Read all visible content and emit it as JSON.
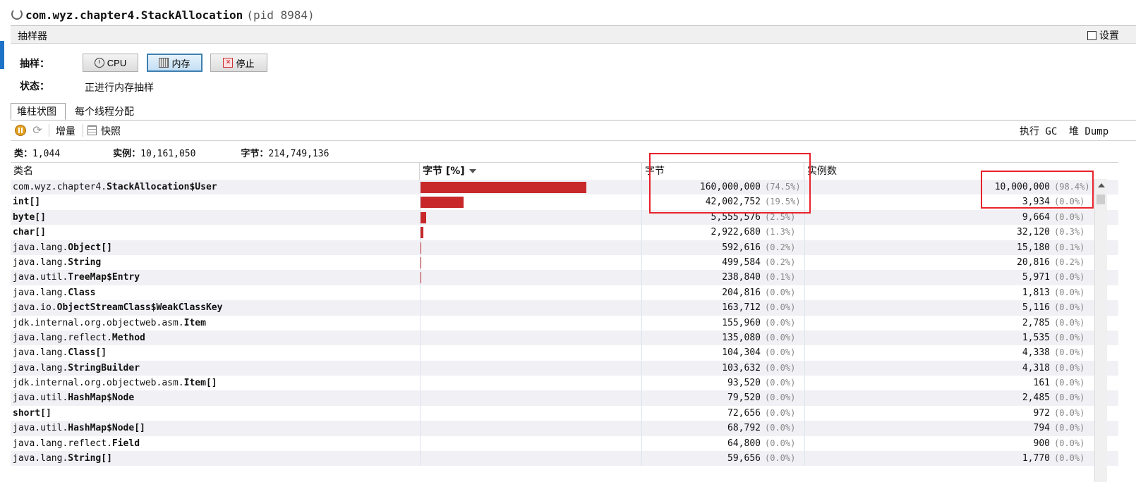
{
  "window": {
    "title_main": "com.wyz.chapter4.StackAllocation",
    "title_pid": "(pid 8984)"
  },
  "sampler": {
    "title": "抽样器",
    "settings_label": "设置",
    "sample_label": "抽样：",
    "status_label": "状态：",
    "status_value": "正进行内存抽样",
    "buttons": {
      "cpu": "CPU",
      "memory": "内存",
      "stop": "停止"
    }
  },
  "tabs": {
    "histogram": "堆柱状图",
    "per_thread": "每个线程分配"
  },
  "toolbar": {
    "delta": "增量",
    "snapshot": "快照",
    "gc": "执行 GC",
    "heap_dump": "堆 Dump"
  },
  "summary": {
    "classes_label": "类：",
    "classes_value": "1,044",
    "instances_label": "实例：",
    "instances_value": "10,161,050",
    "bytes_label": "字节：",
    "bytes_value": "214,749,136"
  },
  "table": {
    "headers": {
      "name": "类名",
      "bar": "字节 [%]",
      "bytes": "字节",
      "instances": "实例数"
    },
    "rows": [
      {
        "pkg": "com.wyz.chapter4.",
        "cls": "StackAllocation$User",
        "bytes": "160,000,000",
        "bytes_pct": "(74.5%)",
        "instances": "10,000,000",
        "inst_pct": "(98.4%)",
        "share": 74.5
      },
      {
        "pkg": "",
        "cls": "int[]",
        "bytes": "42,002,752",
        "bytes_pct": "(19.5%)",
        "instances": "3,934",
        "inst_pct": "(0.0%)",
        "share": 19.5
      },
      {
        "pkg": "",
        "cls": "byte[]",
        "bytes": "5,555,576",
        "bytes_pct": "(2.5%)",
        "instances": "9,664",
        "inst_pct": "(0.0%)",
        "share": 2.5
      },
      {
        "pkg": "",
        "cls": "char[]",
        "bytes": "2,922,680",
        "bytes_pct": "(1.3%)",
        "instances": "32,120",
        "inst_pct": "(0.3%)",
        "share": 1.3
      },
      {
        "pkg": "java.lang.",
        "cls": "Object[]",
        "bytes": "592,616",
        "bytes_pct": "(0.2%)",
        "instances": "15,180",
        "inst_pct": "(0.1%)",
        "share": 0.2
      },
      {
        "pkg": "java.lang.",
        "cls": "String",
        "bytes": "499,584",
        "bytes_pct": "(0.2%)",
        "instances": "20,816",
        "inst_pct": "(0.2%)",
        "share": 0.2
      },
      {
        "pkg": "java.util.",
        "cls": "TreeMap$Entry",
        "bytes": "238,840",
        "bytes_pct": "(0.1%)",
        "instances": "5,971",
        "inst_pct": "(0.0%)",
        "share": 0.1
      },
      {
        "pkg": "java.lang.",
        "cls": "Class",
        "bytes": "204,816",
        "bytes_pct": "(0.0%)",
        "instances": "1,813",
        "inst_pct": "(0.0%)",
        "share": 0
      },
      {
        "pkg": "java.io.",
        "cls": "ObjectStreamClass$WeakClassKey",
        "bytes": "163,712",
        "bytes_pct": "(0.0%)",
        "instances": "5,116",
        "inst_pct": "(0.0%)",
        "share": 0
      },
      {
        "pkg": "jdk.internal.org.objectweb.asm.",
        "cls": "Item",
        "bytes": "155,960",
        "bytes_pct": "(0.0%)",
        "instances": "2,785",
        "inst_pct": "(0.0%)",
        "share": 0
      },
      {
        "pkg": "java.lang.reflect.",
        "cls": "Method",
        "bytes": "135,080",
        "bytes_pct": "(0.0%)",
        "instances": "1,535",
        "inst_pct": "(0.0%)",
        "share": 0
      },
      {
        "pkg": "java.lang.",
        "cls": "Class[]",
        "bytes": "104,304",
        "bytes_pct": "(0.0%)",
        "instances": "4,338",
        "inst_pct": "(0.0%)",
        "share": 0
      },
      {
        "pkg": "java.lang.",
        "cls": "StringBuilder",
        "bytes": "103,632",
        "bytes_pct": "(0.0%)",
        "instances": "4,318",
        "inst_pct": "(0.0%)",
        "share": 0
      },
      {
        "pkg": "jdk.internal.org.objectweb.asm.",
        "cls": "Item[]",
        "bytes": "93,520",
        "bytes_pct": "(0.0%)",
        "instances": "161",
        "inst_pct": "(0.0%)",
        "share": 0
      },
      {
        "pkg": "java.util.",
        "cls": "HashMap$Node",
        "bytes": "79,520",
        "bytes_pct": "(0.0%)",
        "instances": "2,485",
        "inst_pct": "(0.0%)",
        "share": 0
      },
      {
        "pkg": "",
        "cls": "short[]",
        "bytes": "72,656",
        "bytes_pct": "(0.0%)",
        "instances": "972",
        "inst_pct": "(0.0%)",
        "share": 0
      },
      {
        "pkg": "java.util.",
        "cls": "HashMap$Node[]",
        "bytes": "68,792",
        "bytes_pct": "(0.0%)",
        "instances": "794",
        "inst_pct": "(0.0%)",
        "share": 0
      },
      {
        "pkg": "java.lang.reflect.",
        "cls": "Field",
        "bytes": "64,800",
        "bytes_pct": "(0.0%)",
        "instances": "900",
        "inst_pct": "(0.0%)",
        "share": 0
      },
      {
        "pkg": "java.lang.",
        "cls": "String[]",
        "bytes": "59,656",
        "bytes_pct": "(0.0%)",
        "instances": "1,770",
        "inst_pct": "(0.0%)",
        "share": 0
      }
    ]
  },
  "colors": {
    "bar": "#c8282a",
    "annotation": "#e8222a",
    "selected_button": "#3c7fb1"
  },
  "icons": [
    "loading-spinner-icon",
    "clock-icon",
    "memory-icon",
    "stop-icon",
    "pause-icon",
    "refresh-icon",
    "snapshot-icon",
    "sort-desc-icon"
  ]
}
